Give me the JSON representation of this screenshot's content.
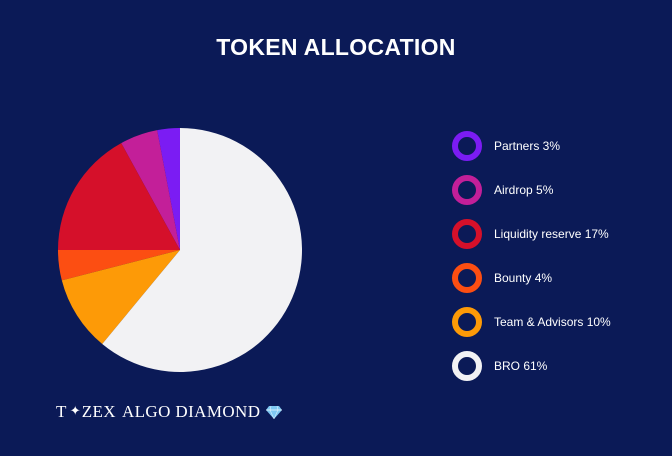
{
  "title": "TOKEN ALLOCATION",
  "brand": {
    "t": "T",
    "star": "✦",
    "zex": "ZEX",
    "name": "ALGO DIAMOND",
    "gem_icon": "diamond-icon",
    "gem_color": "#7ec8f2"
  },
  "chart_data": {
    "type": "pie",
    "title": "TOKEN ALLOCATION",
    "legend_position": "right",
    "slices": [
      {
        "label": "Partners 3%",
        "value": 3,
        "color": "#7b1cf3"
      },
      {
        "label": "Airdrop 5%",
        "value": 5,
        "color": "#c31f99"
      },
      {
        "label": "Liquidity reserve 17%",
        "value": 17,
        "color": "#d5102a"
      },
      {
        "label": "Bounty 4%",
        "value": 4,
        "color": "#fc4e12"
      },
      {
        "label": "Team & Advisors 10%",
        "value": 10,
        "color": "#fd9a07"
      },
      {
        "label": "BRO 61%",
        "value": 61,
        "color": "#f2f2f4"
      }
    ]
  }
}
